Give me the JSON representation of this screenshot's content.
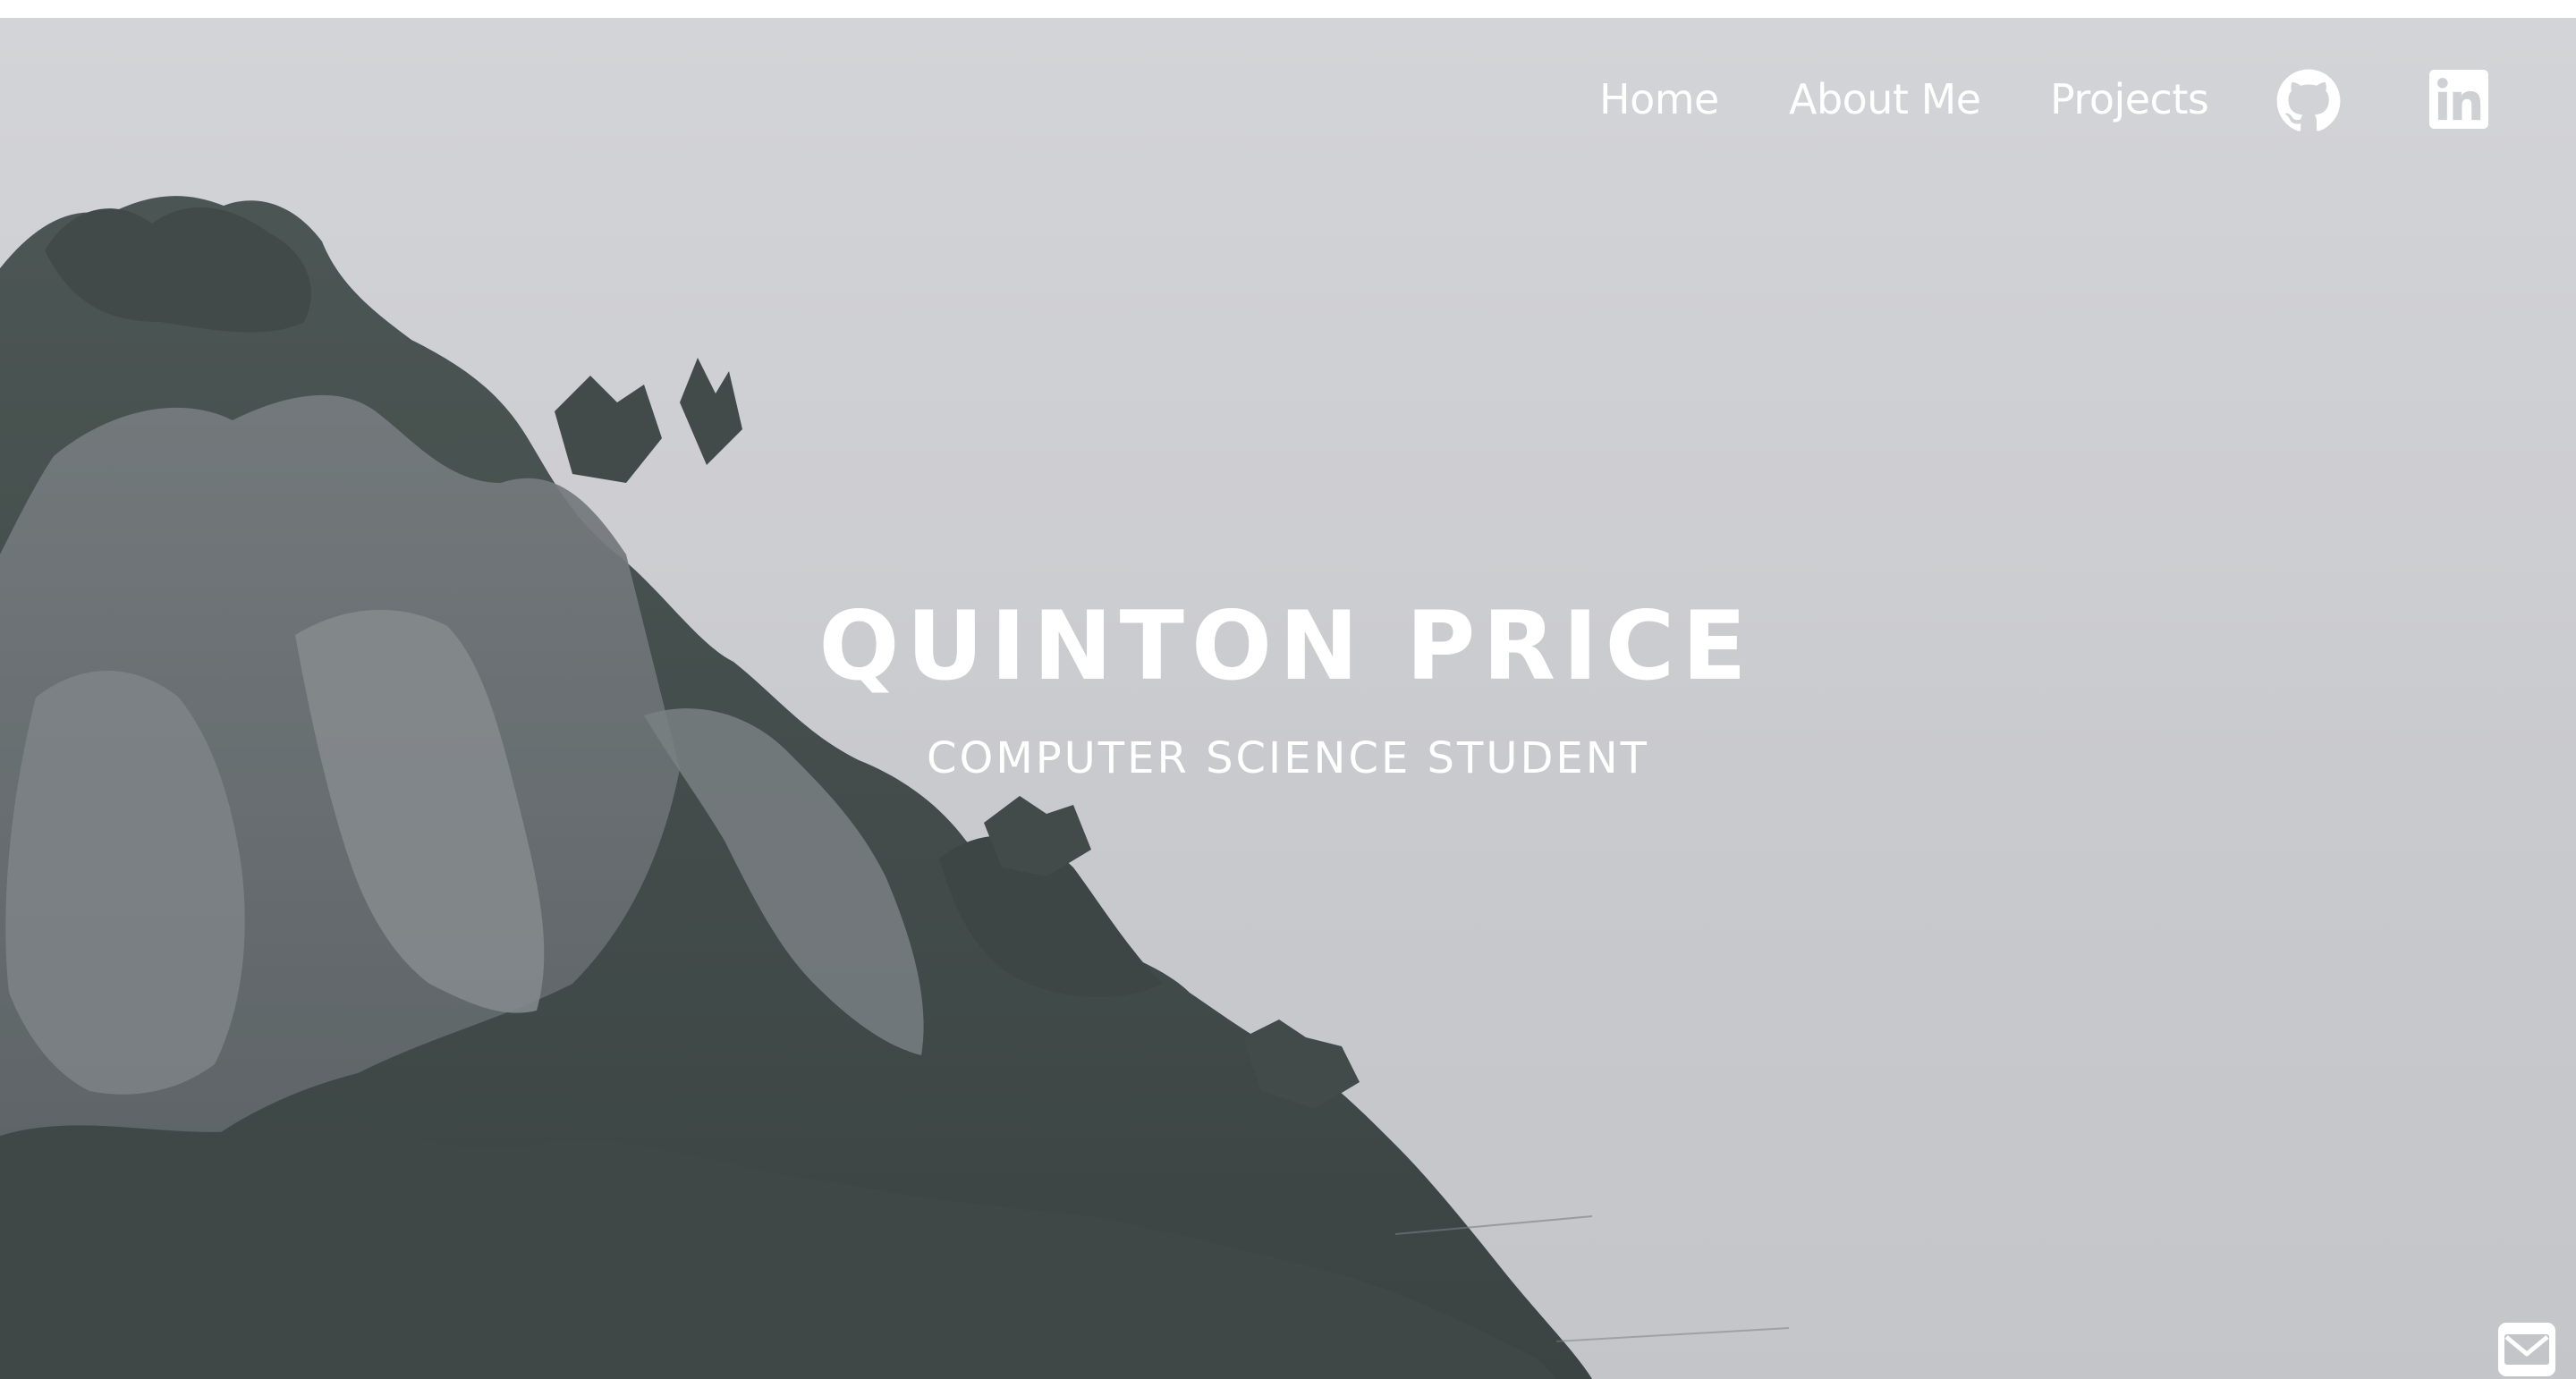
{
  "nav": {
    "home_label": "Home",
    "about_label": "About Me",
    "projects_label": "Projects",
    "github_icon": "github-icon",
    "linkedin_icon": "linkedin-icon"
  },
  "hero": {
    "title": "QUINTON PRICE",
    "subtitle": "COMPUTER SCIENCE STUDENT",
    "background": "misty cliff with pine trees"
  },
  "contact": {
    "mail_icon": "mail-icon"
  },
  "colors": {
    "sky": "#cfd0d3",
    "text": "#ffffff",
    "rock": "#5d6366",
    "foliage": "#2f3a37"
  }
}
